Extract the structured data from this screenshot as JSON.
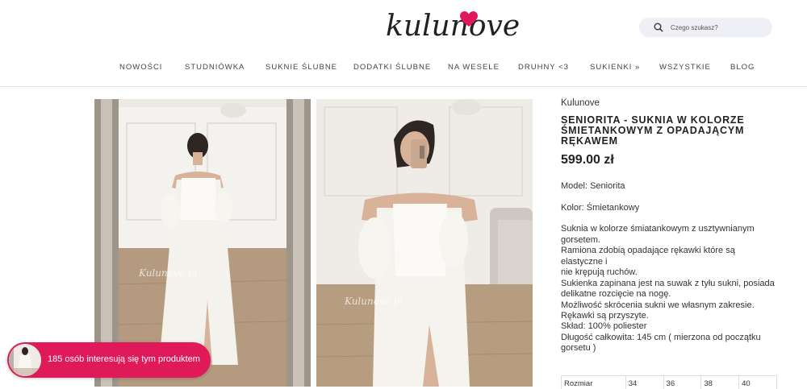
{
  "header": {
    "logo_text": "kulunove",
    "search_placeholder": "Czego szukasz?"
  },
  "nav": [
    {
      "label": "NOWOŚCI"
    },
    {
      "label": "STUDNIÓWKA"
    },
    {
      "label": "SUKNIE ŚLUBNE"
    },
    {
      "label": "DODATKI ŚLUBNE"
    },
    {
      "label": "NA WESELE"
    },
    {
      "label": "DRUHNY <3"
    },
    {
      "label": "SUKIENKI »"
    },
    {
      "label": "WSZYSTKIE"
    },
    {
      "label": "BLOG"
    }
  ],
  "gallery": {
    "watermark": "Kulunove.pl"
  },
  "product": {
    "brand": "Kulunove",
    "title_line1": "SENIORITA - SUKNIA W KOLORZE",
    "title_line2": "ŚMIETANKOWYM Z OPADAJĄCYM",
    "title_line3": "RĘKAWEM",
    "price": "599.00 zł",
    "model": "Model: Seniorita",
    "color": "Kolor: Śmietankowy",
    "desc_lines": [
      "Suknia w kolorze śmiatankowym z usztywnianym",
      "gorsetem.",
      "Ramiona zdobią opadające rękawki które są elastyczne i",
      "nie krępują ruchów.",
      "Sukienka zapinana jest na suwak z tyłu sukni, posiada",
      "delikatne rozcięcie na nogę.",
      "Możliwość skrócenia sukni we własnym zakresie.",
      "Rękawki są przyszyte."
    ],
    "spec_lines": [
      "Skład: 100% poliester",
      "Długość całkowita: 145 cm ( mierzona od początku",
      "gorsetu )"
    ],
    "size_table": [
      "Rozmiar",
      "34",
      "36",
      "38",
      "40"
    ]
  },
  "popup": {
    "text": "185 osób interesują się tym produktem"
  },
  "colors": {
    "accent": "#e0195b",
    "heart": "#e0195b"
  }
}
